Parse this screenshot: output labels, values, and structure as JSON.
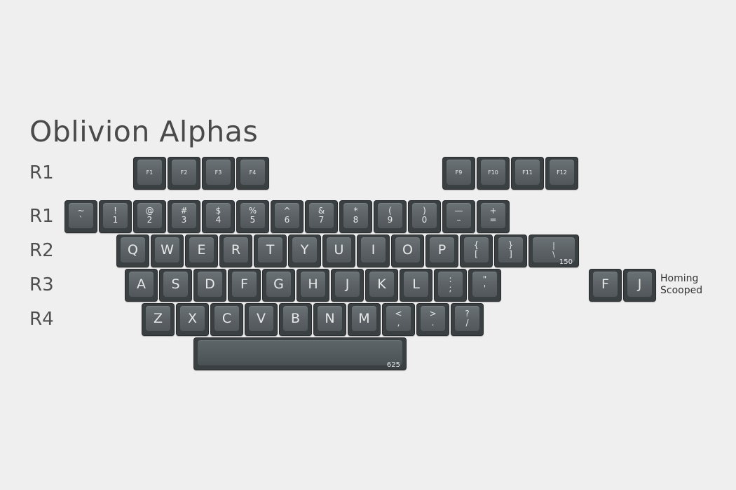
{
  "title": "Oblivion Alphas",
  "row_labels": [
    "R1",
    "R1",
    "R2",
    "R3",
    "R4"
  ],
  "function_left": [
    "F1",
    "F2",
    "F3",
    "F4"
  ],
  "function_right": [
    "F9",
    "F10",
    "F11",
    "F12"
  ],
  "number_row": [
    {
      "top": "~",
      "bottom": "`"
    },
    {
      "top": "!",
      "bottom": "1"
    },
    {
      "top": "@",
      "bottom": "2"
    },
    {
      "top": "#",
      "bottom": "3"
    },
    {
      "top": "$",
      "bottom": "4"
    },
    {
      "top": "%",
      "bottom": "5"
    },
    {
      "top": "^",
      "bottom": "6"
    },
    {
      "top": "&",
      "bottom": "7"
    },
    {
      "top": "*",
      "bottom": "8"
    },
    {
      "top": "(",
      "bottom": "9"
    },
    {
      "top": ")",
      "bottom": "0"
    },
    {
      "top": "—",
      "bottom": "–"
    },
    {
      "top": "+",
      "bottom": "="
    }
  ],
  "qwerty_row": [
    "Q",
    "W",
    "E",
    "R",
    "T",
    "Y",
    "U",
    "I",
    "O",
    "P"
  ],
  "bracket_keys": [
    {
      "top": "{",
      "bottom": "["
    },
    {
      "top": "}",
      "bottom": "]"
    }
  ],
  "backslash_key": {
    "top": "|",
    "bottom": "\\",
    "size": "150"
  },
  "home_row": [
    "A",
    "S",
    "D",
    "F",
    "G",
    "H",
    "J",
    "K",
    "L"
  ],
  "home_punct": [
    {
      "top": ":",
      "bottom": ";"
    },
    {
      "top": "\"",
      "bottom": "'"
    }
  ],
  "bottom_row": [
    "Z",
    "X",
    "C",
    "V",
    "B",
    "N",
    "M"
  ],
  "bottom_punct": [
    {
      "top": "<",
      "bottom": ","
    },
    {
      "top": ">",
      "bottom": "."
    },
    {
      "top": "?",
      "bottom": "/"
    }
  ],
  "spacebar": {
    "size": "625"
  },
  "homing_keys": [
    "F",
    "J"
  ],
  "homing_note": {
    "line1": "Homing",
    "line2": "Scooped"
  },
  "colors": {
    "background": "#efefef",
    "keycap_top": "#6b7276",
    "keycap_side": "#3a3f42",
    "legend": "#e6e8e8"
  }
}
